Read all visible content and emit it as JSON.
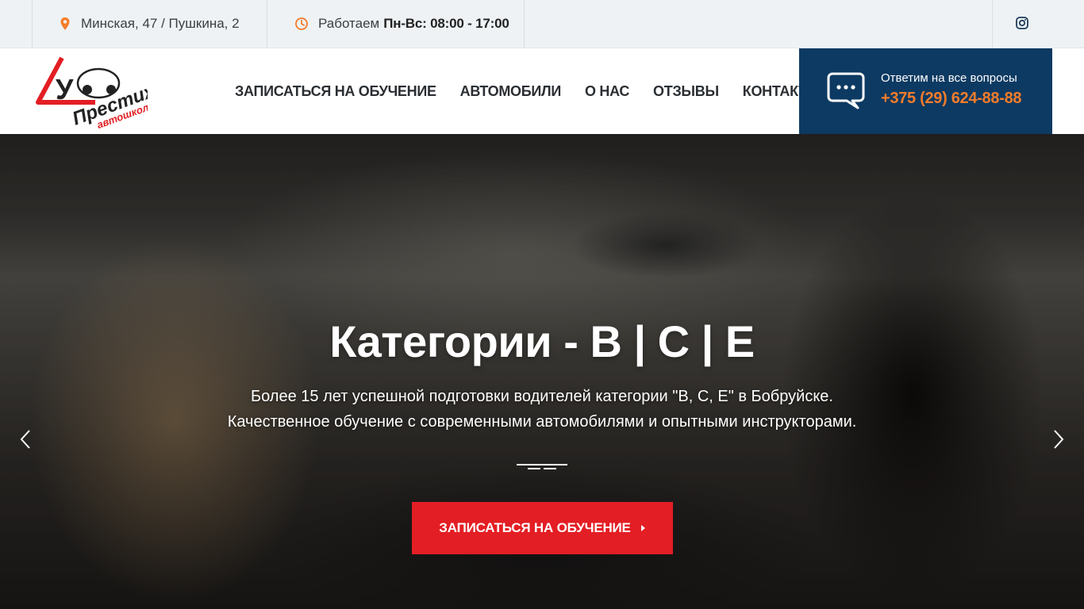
{
  "topbar": {
    "address": "Минская, 47 / Пушкина, 2",
    "hours_prefix": "Работаем",
    "hours_value": "Пн-Вс: 08:00 - 17:00"
  },
  "logo": {
    "main_text": "Престиж",
    "sub_text": "автошкола",
    "badge_letter": "У"
  },
  "nav": {
    "items": [
      {
        "label": "ЗАПИСАТЬСЯ НА ОБУЧЕНИЕ"
      },
      {
        "label": "АВТОМОБИЛИ"
      },
      {
        "label": "О НАС"
      },
      {
        "label": "ОТЗЫВЫ"
      },
      {
        "label": "КОНТАКТЫ"
      }
    ]
  },
  "contact": {
    "label": "Ответим на все вопросы",
    "phone": "+375 (29) 624-88-88"
  },
  "hero": {
    "title": "Категории - B | C | E",
    "subtitle_line1": "Более 15 лет успешной подготовки водителей категории \"B, C, E\" в Бобруйске.",
    "subtitle_line2": "Качественное обучение с современными автомобилями и опытными инструкторами.",
    "cta_label": "ЗАПИСАТЬСЯ НА ОБУЧЕНИЕ"
  },
  "colors": {
    "accent_orange": "#f47c2a",
    "brand_navy": "#0d3a62",
    "cta_red": "#e31e24",
    "topbar_bg": "#eef2f5"
  },
  "icons": {
    "address": "map-pin-icon",
    "hours": "clock-icon",
    "social": "instagram-icon",
    "contact": "chat-bubble-icon",
    "prev": "chevron-left-icon",
    "next": "chevron-right-icon"
  }
}
